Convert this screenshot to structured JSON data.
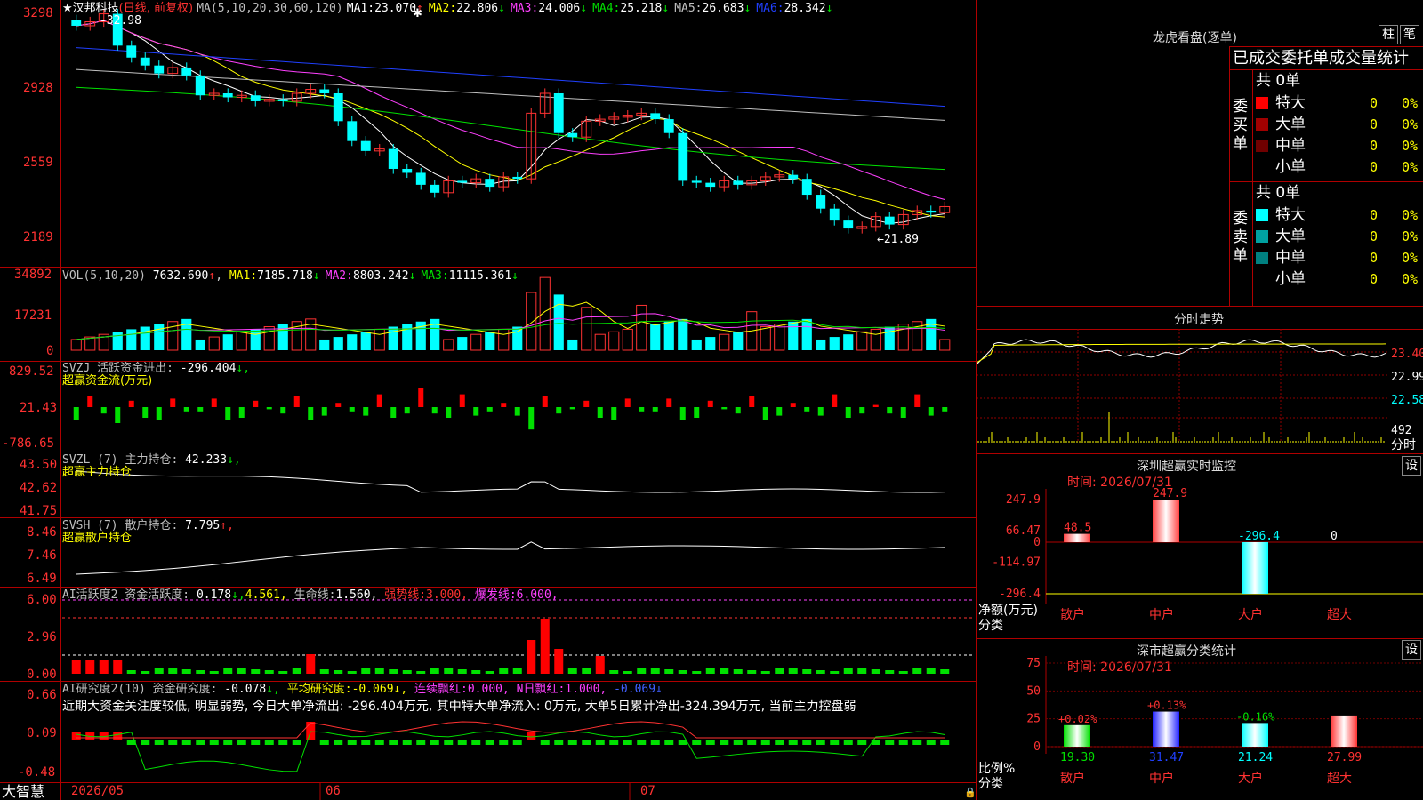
{
  "stock": {
    "name": "汉邦科技",
    "period": "(日线, 前复权)",
    "ma_label": "MA(5,10,20,30,60,120)",
    "ma": [
      {
        "label": "MA1:",
        "value": "23.070",
        "arrow": "↑",
        "color": "#ffffff"
      },
      {
        "label": "MA2:",
        "value": "22.806",
        "arrow": "↓",
        "color": "#ffff00"
      },
      {
        "label": "MA3:",
        "value": "24.006",
        "arrow": "↓",
        "color": "#ff40ff"
      },
      {
        "label": "MA4:",
        "value": "25.218",
        "arrow": "↓",
        "color": "#00e000"
      },
      {
        "label": "MA5:",
        "value": "26.683",
        "arrow": "↓",
        "color": "#c0c0c0"
      },
      {
        "label": "MA6:",
        "value": "28.342",
        "arrow": "↓",
        "color": "#2040ff"
      }
    ],
    "high_mark": "32.98",
    "low_mark": "←21.89",
    "price_ticks": [
      "3298",
      "2928",
      "2559",
      "2189"
    ]
  },
  "vol": {
    "title": "VOL(5,10,20)",
    "value": "7632.690",
    "value_arrow": "↑",
    "ma": [
      {
        "label": "MA1:",
        "value": "7185.718",
        "arrow": "↓",
        "color": "#ffff00"
      },
      {
        "label": "MA2:",
        "value": "8803.242",
        "arrow": "↓",
        "color": "#ff40ff"
      },
      {
        "label": "MA3:",
        "value": "11115.361",
        "arrow": "↓",
        "color": "#00e000"
      }
    ],
    "ticks": [
      "34892",
      "17231",
      "0"
    ]
  },
  "svzj": {
    "title": "SVZJ 活跃资金进出:",
    "value": "-296.404",
    "arrow": "↓,",
    "subtitle": "超赢资金流(万元)",
    "ticks": [
      "829.52",
      "21.43",
      "-786.65"
    ]
  },
  "svzl": {
    "title": "SVZL (7) 主力持仓:",
    "value": "42.233",
    "arrow": "↓,",
    "subtitle": "超赢主力持仓",
    "ticks": [
      "43.50",
      "42.62",
      "41.75"
    ]
  },
  "svsh": {
    "title": "SVSH (7) 散户持仓:",
    "value": "7.795",
    "arrow": "↑,",
    "subtitle": "超赢散户持仓",
    "ticks": [
      "8.46",
      "7.46",
      "6.49"
    ]
  },
  "ai_active": {
    "title": "AI活跃度2 资金活跃度:",
    "value1": "0.178",
    "arrow1": "↓,",
    "value2": "4.561,",
    "life_label": "生命线:",
    "life_value": "1.560,",
    "strong_label": "强势线:",
    "strong_value": "3.000,",
    "burst_label": "爆发线:",
    "burst_value": "6.000,",
    "ticks": [
      "6.00",
      "2.96",
      "0.00"
    ]
  },
  "ai_research": {
    "title": "AI研究度2(10) 资金研究度:",
    "value": "-0.078",
    "arrow": "↓,",
    "avg_label": "平均研究度:",
    "avg_value": "-0.069",
    "avg_arrow": "↓,",
    "cont_label": "连续飘红:",
    "cont_value": "0.000,",
    "n_label": "N日飘红:",
    "n_value": "1.000,",
    "last_value": "-0.069↓",
    "comment": "近期大资金关注度较低, 明显弱势, 今日大单净流出: -296.404万元, 其中特大单净流入: 0万元, 大单5日累计净出-324.394万元, 当前主力控盘弱",
    "ticks": [
      "0.66",
      "0.09",
      "-0.48"
    ]
  },
  "footer": {
    "brand": "大智慧",
    "dates": [
      "2026/05",
      "06",
      "07"
    ]
  },
  "longhu": {
    "title": "龙虎看盘(逐单)",
    "btn_bar": "柱",
    "btn_pen": "笔",
    "header": "已成交委托单成交量统计",
    "buy": {
      "label": "委买单",
      "total": "共 0单",
      "rows": [
        {
          "name": "特大",
          "value": "0",
          "pct": "0%",
          "color": "#ff0000"
        },
        {
          "name": "大单",
          "value": "0",
          "pct": "0%",
          "color": "#a00000"
        },
        {
          "name": "中单",
          "value": "0",
          "pct": "0%",
          "color": "#700000"
        },
        {
          "name": "小单",
          "value": "0",
          "pct": "0%",
          "color": ""
        }
      ]
    },
    "sell": {
      "label": "委卖单",
      "total": "共 0单",
      "rows": [
        {
          "name": "特大",
          "value": "0",
          "pct": "0%",
          "color": "#00ffff"
        },
        {
          "name": "大单",
          "value": "0",
          "pct": "0%",
          "color": "#00a0a0"
        },
        {
          "name": "中单",
          "value": "0",
          "pct": "0%",
          "color": "#008080"
        },
        {
          "name": "小单",
          "value": "0",
          "pct": "0%",
          "color": ""
        }
      ]
    }
  },
  "intraday": {
    "title": "分时走势",
    "ticks": [
      "23.40",
      "22.99",
      "22.58"
    ],
    "vol_tick": "492",
    "vol_label": "分时"
  },
  "sz_monitor": {
    "title": "深圳超赢实时监控",
    "btn": "设",
    "time_label": "时间: 2026/07/31",
    "ticks": [
      "247.9",
      "66.47",
      "0",
      "-114.97",
      "-296.4"
    ],
    "net_label": "净额(万元)",
    "cat_label": "分类",
    "categories": [
      "散户",
      "中户",
      "大户",
      "超大"
    ],
    "values": [
      48.5,
      247.9,
      -296.4,
      0
    ],
    "value_labels": [
      "48.5",
      "247.9",
      "-296.4",
      "0"
    ]
  },
  "sz_stats": {
    "title": "深市超赢分类统计",
    "btn": "设",
    "time_label": "时间: 2026/07/31",
    "ticks": [
      "75",
      "50",
      "25",
      "0"
    ],
    "ratio_label": "比例%",
    "cat_label": "分类",
    "categories": [
      "散户",
      "中户",
      "大户",
      "超大"
    ],
    "values": [
      19.3,
      31.47,
      21.24,
      27.99
    ],
    "value_labels": [
      "19.30",
      "31.47",
      "21.24",
      "27.99"
    ],
    "changes": [
      "+0.02%",
      "+0.13%",
      "-0.16%",
      ""
    ]
  },
  "chart_data": [
    {
      "type": "bar",
      "title": "深圳超赢实时监控",
      "ylabel": "净额(万元)",
      "xlabel": "分类",
      "categories": [
        "散户",
        "中户",
        "大户",
        "超大"
      ],
      "values": [
        48.5,
        247.9,
        -296.4,
        0
      ],
      "ylim": [
        -296.4,
        247.9
      ]
    },
    {
      "type": "bar",
      "title": "深市超赢分类统计",
      "ylabel": "比例%",
      "xlabel": "分类",
      "categories": [
        "散户",
        "中户",
        "大户",
        "超大"
      ],
      "values": [
        19.3,
        31.47,
        21.24,
        27.99
      ],
      "ylim": [
        0,
        75
      ]
    }
  ]
}
